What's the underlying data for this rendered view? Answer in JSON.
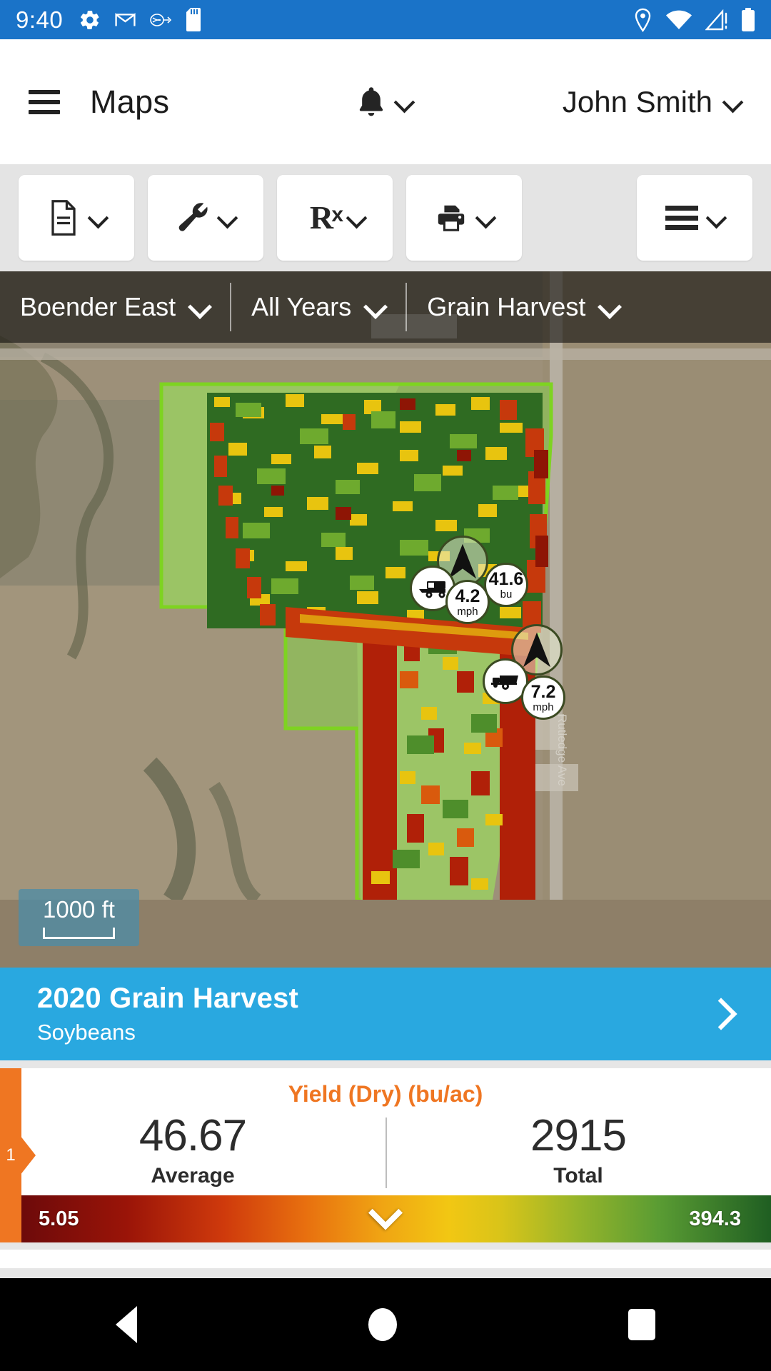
{
  "status_bar": {
    "time": "9:40",
    "left_icons": [
      "settings-gear-icon",
      "gmail-icon",
      "usb-debug-icon",
      "sd-card-icon"
    ],
    "right_icons": [
      "location-pin-icon",
      "wifi-icon",
      "cell-signal-alert-icon",
      "battery-full-icon"
    ]
  },
  "app_bar": {
    "menu_icon": "hamburger-menu-icon",
    "title": "Maps",
    "notification_icon": "bell-icon",
    "notification_chevron": "chevron-down-icon",
    "user_name": "John Smith",
    "user_chevron": "chevron-down-icon"
  },
  "toolbar": {
    "buttons": [
      {
        "name": "report",
        "icon": "document-icon",
        "chevron": "chevron-down-icon"
      },
      {
        "name": "tools",
        "icon": "wrench-icon",
        "chevron": "chevron-down-icon"
      },
      {
        "name": "prescription",
        "icon": "rx-icon",
        "chevron": "chevron-down-icon"
      },
      {
        "name": "print",
        "icon": "printer-icon",
        "chevron": ""
      },
      {
        "name": "more",
        "icon": "list-lines-icon",
        "chevron": "chevron-down-icon"
      }
    ],
    "rx_label": "R",
    "rx_sub": "x"
  },
  "map": {
    "filters": [
      {
        "label": "Boender East",
        "chevron": "chevron-down-icon"
      },
      {
        "label": "All Years",
        "chevron": "chevron-down-icon"
      },
      {
        "label": "Grain Harvest",
        "chevron": "chevron-down-icon"
      }
    ],
    "scale_label": "1000 ft",
    "markers": [
      {
        "type": "heading-arrow-marker",
        "label": ""
      },
      {
        "type": "combine-harvester-marker",
        "label": ""
      },
      {
        "type": "speed-marker",
        "value": "4.2",
        "unit": "mph"
      },
      {
        "type": "yield-marker",
        "value": "41.6",
        "unit": "bu"
      },
      {
        "type": "heading-arrow-marker",
        "label": ""
      },
      {
        "type": "grain-cart-marker",
        "label": ""
      },
      {
        "type": "speed-marker",
        "value": "7.2",
        "unit": "mph"
      }
    ],
    "street_label": "Rutledge Ave"
  },
  "banner": {
    "title": "2020 Grain Harvest",
    "subtitle": "Soybeans",
    "arrow": "chevron-right-icon"
  },
  "stats": {
    "tab_index": "1",
    "title": "Yield (Dry) (bu/ac)",
    "average_value": "46.67",
    "average_label": "Average",
    "total_value": "2915",
    "total_label": "Total"
  },
  "legend": {
    "min": "5.05",
    "max": "394.3",
    "caret": "chevron-down-icon"
  },
  "nav_bar": {
    "back": "back-triangle-icon",
    "home": "home-circle-icon",
    "recents": "recents-square-icon"
  },
  "colors": {
    "status_bar": "#1a73c8",
    "banner": "#29a8e0",
    "accent_orange": "#ef7622",
    "toolbar_bg": "#e4e4e4"
  },
  "chart_data": {
    "type": "heatmap",
    "title": "Yield (Dry) (bu/ac)",
    "legend_min": 5.05,
    "legend_max": 394.3,
    "average": 46.67,
    "total": 2915,
    "units": "bu/ac",
    "crop": "Soybeans",
    "season": "2020 Grain Harvest",
    "field": "Boender East",
    "colormap": [
      "#6d0a0a",
      "#9a1408",
      "#cf3a0c",
      "#e8700f",
      "#f0a413",
      "#f2c713",
      "#97b52a",
      "#5a9c33",
      "#1f5e22"
    ]
  }
}
